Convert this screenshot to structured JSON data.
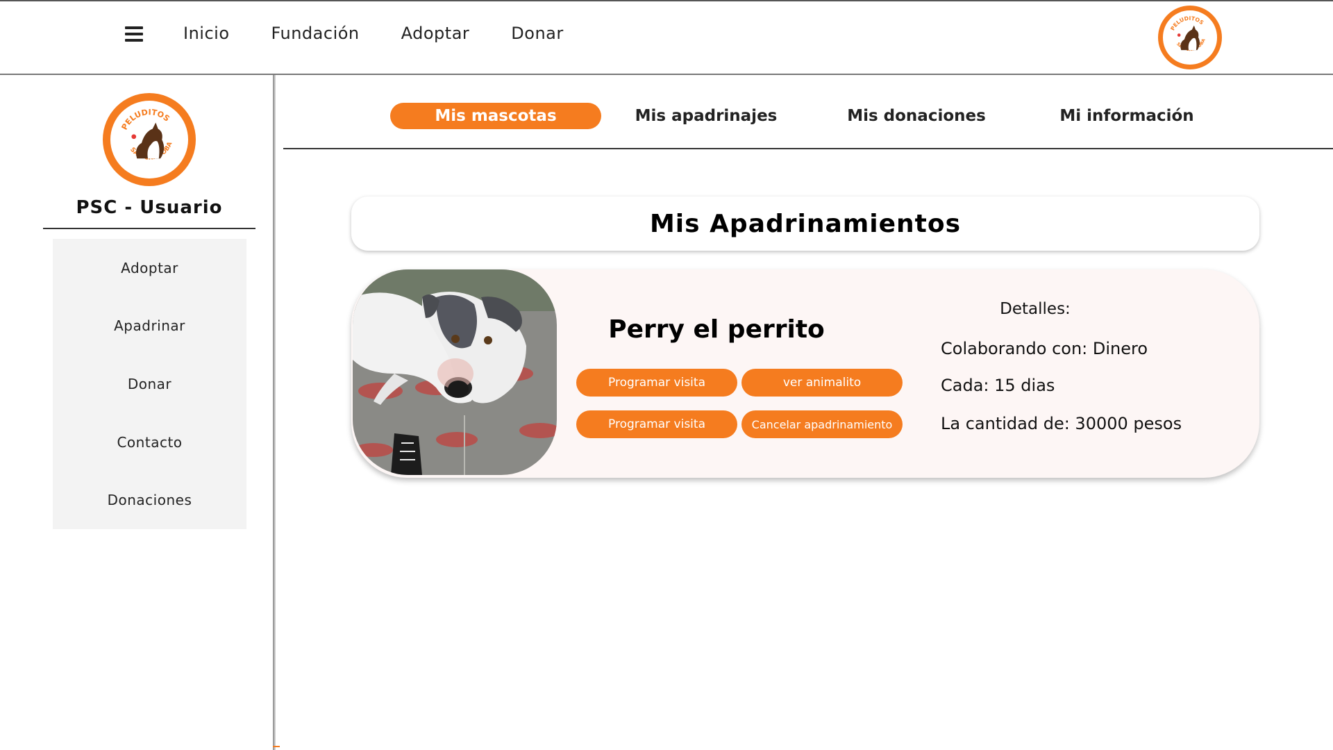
{
  "topnav": {
    "menu_icon": "hamburger-menu-icon",
    "links": [
      "Inicio",
      "Fundación",
      "Adoptar",
      "Donar"
    ],
    "logo": "peluditos-san-cristobal-logo"
  },
  "logo_text": {
    "top": "PELUDITOS",
    "bottom": "SAN CRISTOBAL"
  },
  "sidebar": {
    "user_title": "PSC - Usuario",
    "items": [
      "Adoptar",
      "Apadrinar",
      "Donar",
      "Contacto",
      "Donaciones"
    ]
  },
  "tabs": [
    {
      "label": "Mis mascotas",
      "active": true
    },
    {
      "label": "Mis apadrinajes",
      "active": false
    },
    {
      "label": "Mis donaciones",
      "active": false
    },
    {
      "label": "Mi información",
      "active": false
    }
  ],
  "section": {
    "title": "Mis Apadrinamientos"
  },
  "sponsorship": {
    "pet_name": "Perry el perrito",
    "buttons": {
      "schedule_visit_1": "Programar visita",
      "view_animal": "ver animalito",
      "schedule_visit_2": "Programar visita",
      "cancel": "Cancelar apadrinamiento"
    },
    "details_title": "Detalles:",
    "details": {
      "collaborating": "Colaborando con: Dinero",
      "frequency": "Cada: 15 dias",
      "amount": "La cantidad de: 30000 pesos"
    }
  },
  "colors": {
    "accent": "#f57c1f",
    "card_background": "#fdf6f5",
    "menu_background": "#f3f3f3"
  }
}
